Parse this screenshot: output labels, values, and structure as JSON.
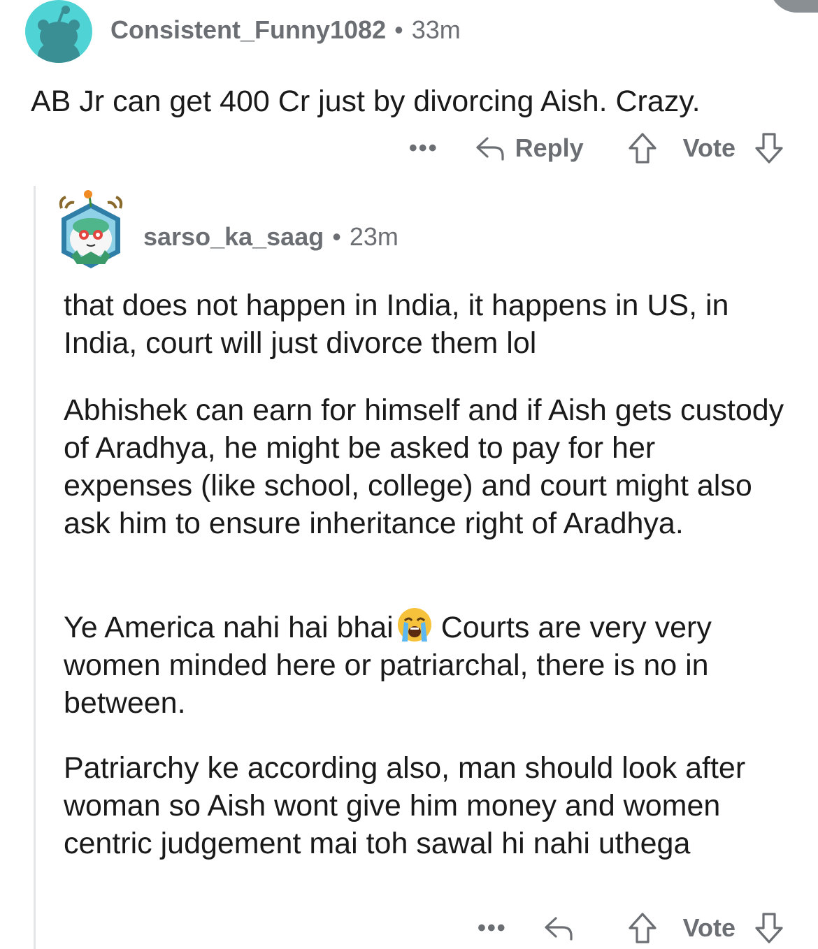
{
  "comments": [
    {
      "username": "Consistent_Funny1082",
      "separator": "•",
      "time": "33m",
      "body": "AB Jr can get 400 Cr just by divorcing Aish. Crazy.",
      "actions": {
        "more_label": "•••",
        "reply_label": "Reply",
        "vote_label": "Vote"
      },
      "avatar_icon": "reddit-snoo-avatar-icon",
      "avatar_color": "#4fd3d4"
    },
    {
      "username": "sarso_ka_saag",
      "separator": "•",
      "time": "23m",
      "paragraphs": [
        "that does not happen in India, it happens in US, in India, court will just divorce them lol",
        "Abhishek can earn for himself and if Aish gets custody of Aradhya, he might be asked to pay for her expenses (like school, college) and court might also ask him to ensure inheritance right of Aradhya.",
        {
          "before_emoji": "Ye America nahi hai bhai",
          "emoji": "loudly-crying-face-emoji",
          "after_emoji": "Courts are very very women minded here or patriarchal, there is no in between."
        },
        "Patriarchy ke according also, man should look after woman so Aish wont give him money and women centric judgement mai toh sawal hi nahi uthega"
      ],
      "actions": {
        "more_label": "•••",
        "vote_label": "Vote"
      },
      "avatar_icon": "hexagon-creature-avatar-icon"
    }
  ],
  "colors": {
    "meta_text": "#6b6e72",
    "body_text": "#1a1a1b",
    "thread_line": "#e3e5e7"
  }
}
